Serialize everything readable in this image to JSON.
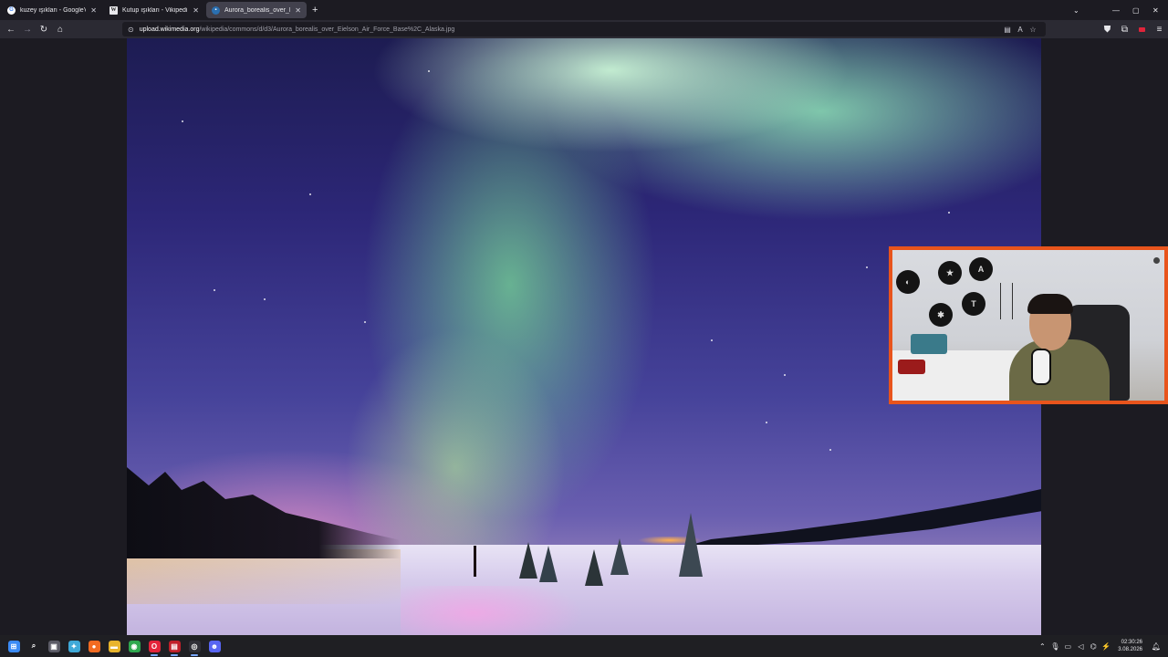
{
  "tabs": [
    {
      "title": "kuzey ışıkları - Google'da Ara",
      "icon": "google-icon",
      "active": false
    },
    {
      "title": "Kutup ışıkları - Vikipedi",
      "icon": "wikipedia-icon",
      "active": false
    },
    {
      "title": "Aurora_borealis_over_Eielson_A",
      "icon": "image-icon",
      "active": true
    }
  ],
  "tabbar": {
    "new_tab": "+",
    "list_tabs": "⌄",
    "minimize": "—",
    "maximize": "▢",
    "close": "✕"
  },
  "nav": {
    "url_host": "upload.wikimedia.org",
    "url_path": "/wikipedia/commons/d/d3/Aurora_borealis_over_Eielson_Air_Force_Base%2C_Alaska.jpg"
  },
  "taskbar": {
    "time": "02:30:26",
    "date": "3.08.2026",
    "apps": [
      {
        "name": "windows-start-icon",
        "glyph": "⊞",
        "color": "#3b8bf5"
      },
      {
        "name": "search-icon",
        "glyph": "⌕",
        "color": "transparent"
      },
      {
        "name": "task-view-icon",
        "glyph": "▣",
        "color": "#5b5b66"
      },
      {
        "name": "copilot-icon",
        "glyph": "✦",
        "color": "#3fa9d8"
      },
      {
        "name": "firefox-icon",
        "glyph": "●",
        "color": "#f26b21"
      },
      {
        "name": "file-explorer-icon",
        "glyph": "▬",
        "color": "#e8b42c"
      },
      {
        "name": "chrome-icon",
        "glyph": "◉",
        "color": "#2fa84f"
      },
      {
        "name": "opera-icon",
        "glyph": "O",
        "color": "#e3243a"
      },
      {
        "name": "streaming-app-icon",
        "glyph": "▤",
        "color": "#c0202a"
      },
      {
        "name": "obs-icon",
        "glyph": "◎",
        "color": "#303038"
      },
      {
        "name": "discord-icon",
        "glyph": "☻",
        "color": "#5865f2"
      }
    ]
  }
}
